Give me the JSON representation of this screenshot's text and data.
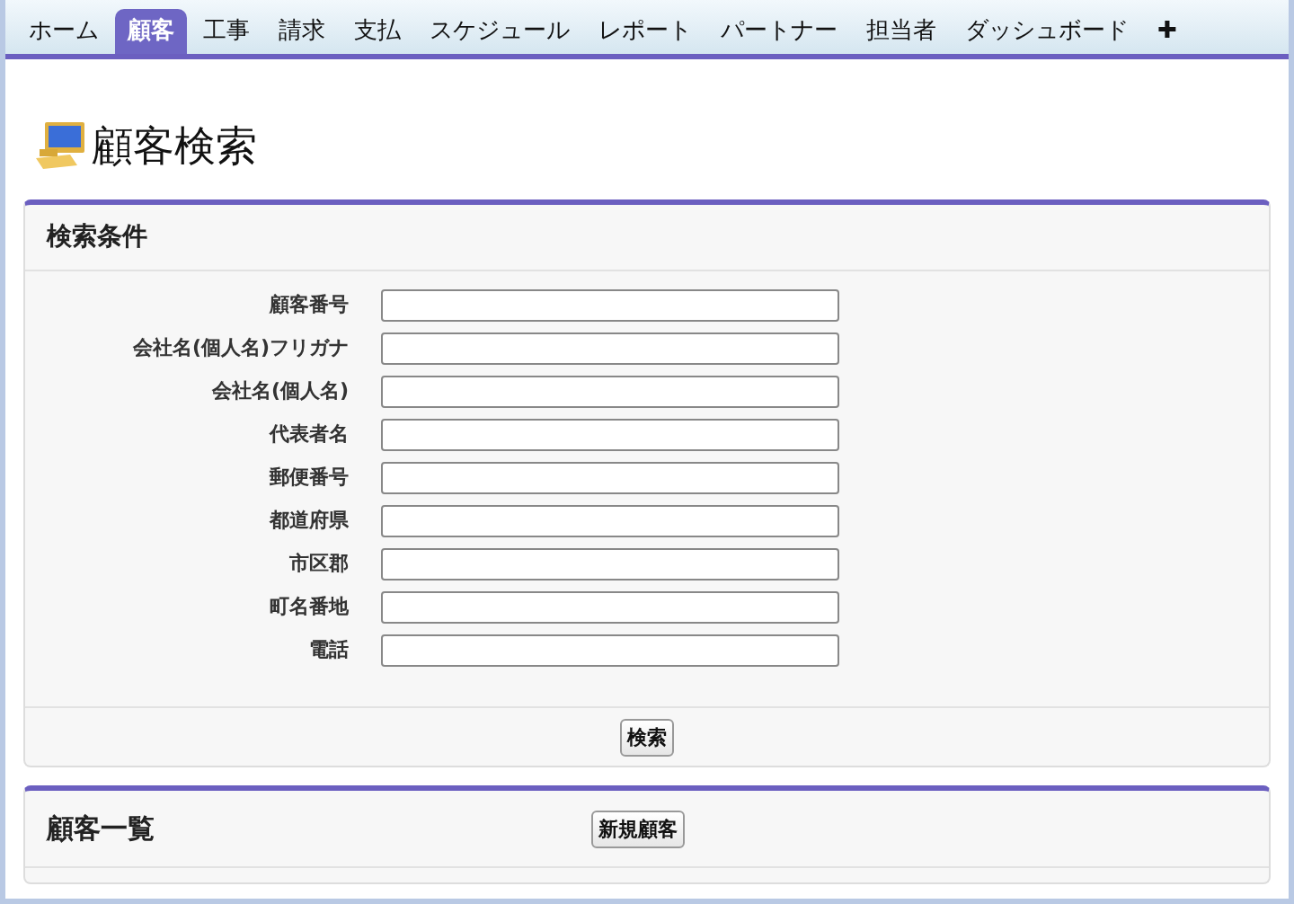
{
  "tabs": [
    {
      "label": "ホーム",
      "selected": false
    },
    {
      "label": "顧客",
      "selected": true
    },
    {
      "label": "工事",
      "selected": false
    },
    {
      "label": "請求",
      "selected": false
    },
    {
      "label": "支払",
      "selected": false
    },
    {
      "label": "スケジュール",
      "selected": false
    },
    {
      "label": "レポート",
      "selected": false
    },
    {
      "label": "パートナー",
      "selected": false
    },
    {
      "label": "担当者",
      "selected": false
    },
    {
      "label": "ダッシュボード",
      "selected": false
    },
    {
      "label": "✚",
      "selected": false
    }
  ],
  "page_title": "顧客検索",
  "search_panel": {
    "title": "検索条件",
    "fields": [
      {
        "label": "顧客番号"
      },
      {
        "label": "会社名(個人名)フリガナ"
      },
      {
        "label": "会社名(個人名)"
      },
      {
        "label": "代表者名"
      },
      {
        "label": "郵便番号"
      },
      {
        "label": "都道府県"
      },
      {
        "label": "市区郡"
      },
      {
        "label": "町名番地"
      },
      {
        "label": "電話"
      }
    ],
    "button": "検索"
  },
  "list_panel": {
    "title": "顧客一覧",
    "button": "新規顧客"
  }
}
